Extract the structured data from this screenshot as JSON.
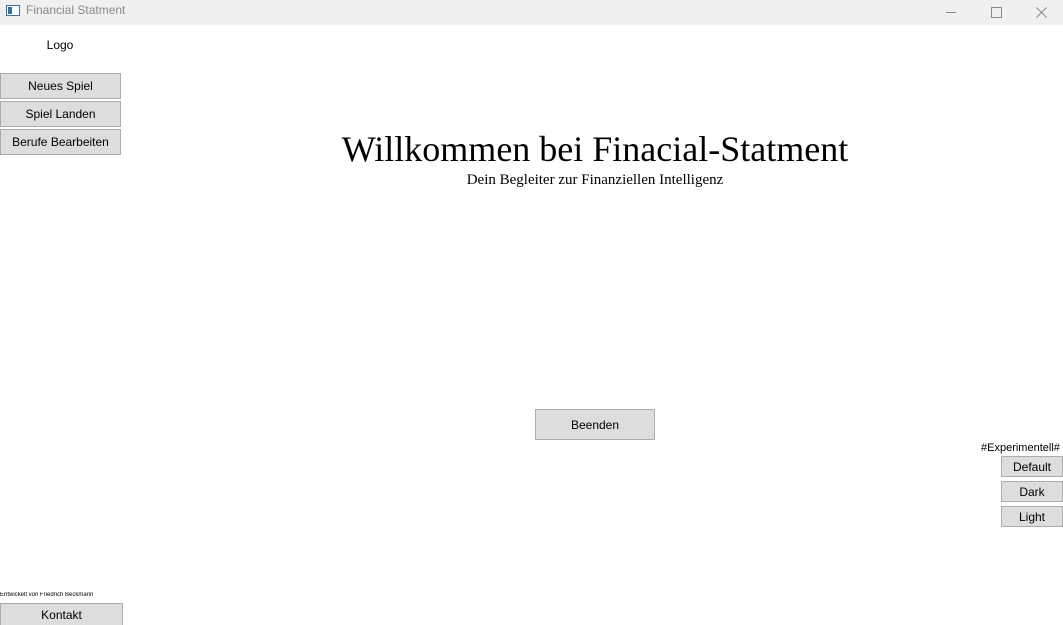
{
  "window": {
    "title": "Financial Statment",
    "controls": {
      "minimize_icon": "minimize-icon",
      "maximize_icon": "maximize-icon",
      "close_icon": "close-icon"
    }
  },
  "sidebar": {
    "logo": "Logo",
    "items": [
      {
        "label": "Neues Spiel"
      },
      {
        "label": "Spiel Landen"
      },
      {
        "label": "Berufe Bearbeiten"
      }
    ],
    "developer_credit": "Entwickelt von Friedrich Beckmann",
    "contact_label": "Kontakt"
  },
  "main": {
    "title": "Willkommen bei Finacial-Statment",
    "subtitle": "Dein Begleiter zur Finanziellen Intelligenz",
    "quit_label": "Beenden"
  },
  "theme_panel": {
    "label": "#Experimentell#",
    "options": [
      {
        "label": "Default"
      },
      {
        "label": "Dark"
      },
      {
        "label": "Light"
      }
    ]
  },
  "colors": {
    "button_background": "#dddddd",
    "button_border": "#adadad",
    "titlebar_background": "#f0f0f0"
  }
}
